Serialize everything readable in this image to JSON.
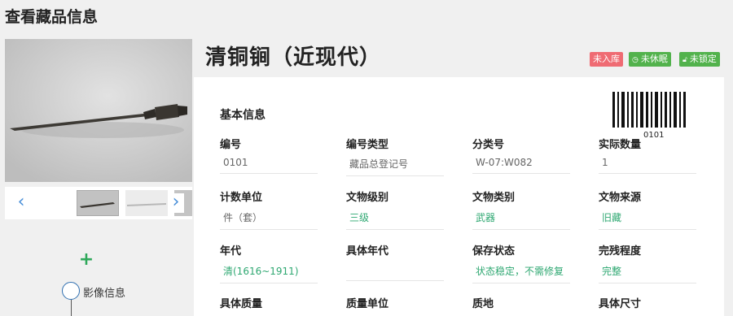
{
  "page": {
    "title": "查看藏品信息"
  },
  "media": {
    "timeline_label": "影像信息"
  },
  "item": {
    "title": "清铜锏（近现代）",
    "badges": [
      "未入库",
      "未休眠",
      "未锁定"
    ]
  },
  "basic_info": {
    "section_title": "基本信息",
    "barcode_number": "0101",
    "fields": [
      {
        "label": "编号",
        "value": "0101"
      },
      {
        "label": "编号类型",
        "value": "藏品总登记号"
      },
      {
        "label": "分类号",
        "value": "W-07:W082"
      },
      {
        "label": "实际数量",
        "value": "1"
      },
      {
        "label": "计数单位",
        "value": "件（套）"
      },
      {
        "label": "文物级别",
        "value": "三级"
      },
      {
        "label": "文物类别",
        "value": "武器"
      },
      {
        "label": "文物来源",
        "value": "旧藏"
      },
      {
        "label": "年代",
        "value": "清(1616~1911)"
      },
      {
        "label": "具体年代",
        "value": ""
      },
      {
        "label": "保存状态",
        "value": "状态稳定，不需修复"
      },
      {
        "label": "完残程度",
        "value": "完整"
      },
      {
        "label": "具体质量",
        "value": ""
      },
      {
        "label": "质量单位",
        "value": ""
      },
      {
        "label": "质地",
        "value": ""
      },
      {
        "label": "具体尺寸",
        "value": ""
      }
    ]
  },
  "colors": {
    "accent_green": "#2fa872",
    "badge_red": "#ef6b73",
    "badge_green": "#52b24c",
    "link_blue": "#4a90d9"
  }
}
